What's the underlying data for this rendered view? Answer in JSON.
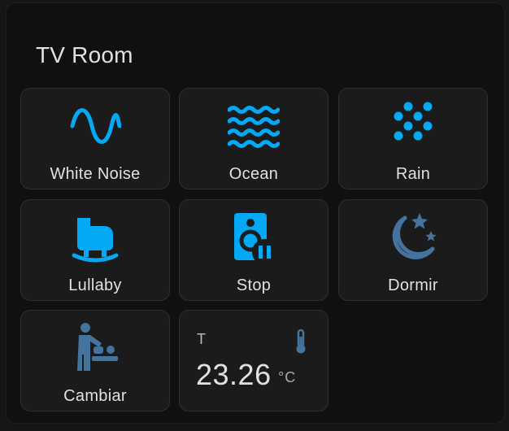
{
  "card": {
    "title": "TV Room"
  },
  "tiles": [
    {
      "label": "White Noise",
      "icon": "sine-wave-icon",
      "color": "#03a9f4"
    },
    {
      "label": "Ocean",
      "icon": "waves-icon",
      "color": "#03a9f4"
    },
    {
      "label": "Rain",
      "icon": "rain-dots-icon",
      "color": "#03a9f4"
    },
    {
      "label": "Lullaby",
      "icon": "cradle-icon",
      "color": "#03a9f4"
    },
    {
      "label": "Stop",
      "icon": "speaker-pause-icon",
      "color": "#03a9f4"
    },
    {
      "label": "Dormir",
      "icon": "moon-stars-icon",
      "color": "#44739e"
    },
    {
      "label": "Cambiar",
      "icon": "baby-changing-icon",
      "color": "#44739e"
    }
  ],
  "sensor": {
    "name": "T",
    "value": "23.26",
    "unit": "°C",
    "icon": "thermometer-icon",
    "icon_color": "#44739e"
  }
}
